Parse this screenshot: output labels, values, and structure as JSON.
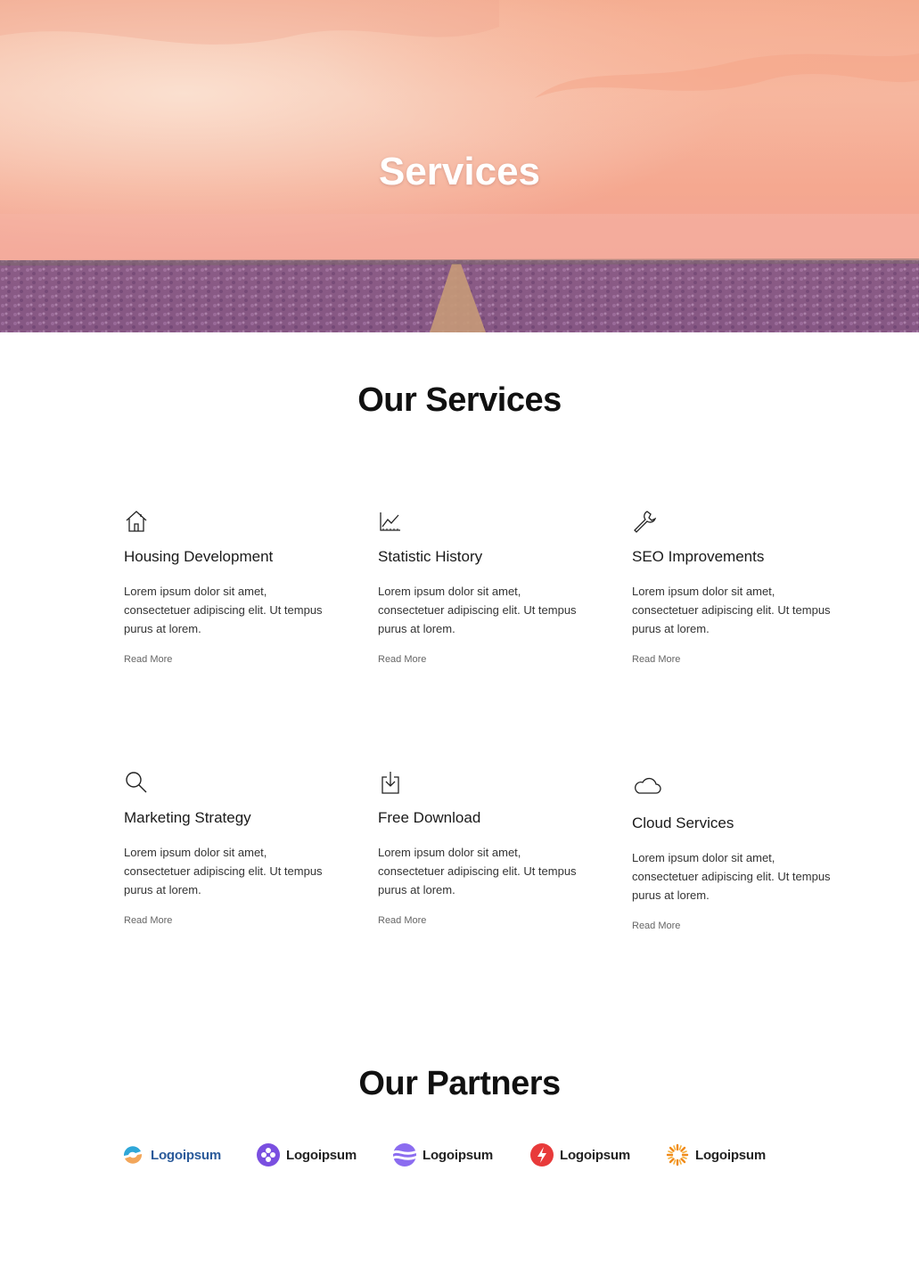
{
  "hero": {
    "title": "Services"
  },
  "services_section": {
    "title": "Our Services",
    "cards": [
      {
        "icon": "house-icon",
        "title": "Housing Development",
        "desc": "Lorem ipsum dolor sit amet, consectetuer adipiscing elit. Ut tempus purus at lorem.",
        "link": "Read More"
      },
      {
        "icon": "line-chart-icon",
        "title": "Statistic History",
        "desc": "Lorem ipsum dolor sit amet, consectetuer adipiscing elit. Ut tempus purus at lorem.",
        "link": "Read More"
      },
      {
        "icon": "wrench-icon",
        "title": "SEO Improvements",
        "desc": "Lorem ipsum dolor sit amet, consectetuer adipiscing elit. Ut tempus purus at lorem.",
        "link": "Read More"
      },
      {
        "icon": "search-icon",
        "title": "Marketing Strategy",
        "desc": "Lorem ipsum dolor sit amet, consectetuer adipiscing elit. Ut tempus purus at lorem.",
        "link": "Read More"
      },
      {
        "icon": "download-icon",
        "title": "Free Download",
        "desc": "Lorem ipsum dolor sit amet, consectetuer adipiscing elit. Ut tempus purus at lorem.",
        "link": "Read More"
      },
      {
        "icon": "cloud-icon",
        "title": "Cloud Services",
        "desc": "Lorem ipsum dolor sit amet, consectetuer adipiscing elit. Ut tempus purus at lorem.",
        "link": "Read More"
      }
    ]
  },
  "partners_section": {
    "title": "Our Partners",
    "logos": [
      {
        "icon": "swirl-logo-icon",
        "name": "Logoipsum",
        "color": "#2a5a9a"
      },
      {
        "icon": "flower-logo-icon",
        "name": "Logoipsum",
        "color": "#7a4fe0"
      },
      {
        "icon": "wave-logo-icon",
        "name": "Logoipsum",
        "color": "#6a3fd8"
      },
      {
        "icon": "bolt-logo-icon",
        "name": "Logoipsum",
        "color": "#e83a3a"
      },
      {
        "icon": "sunburst-logo-icon",
        "name": "Logoipsum",
        "color": "#f08a1a"
      }
    ]
  }
}
